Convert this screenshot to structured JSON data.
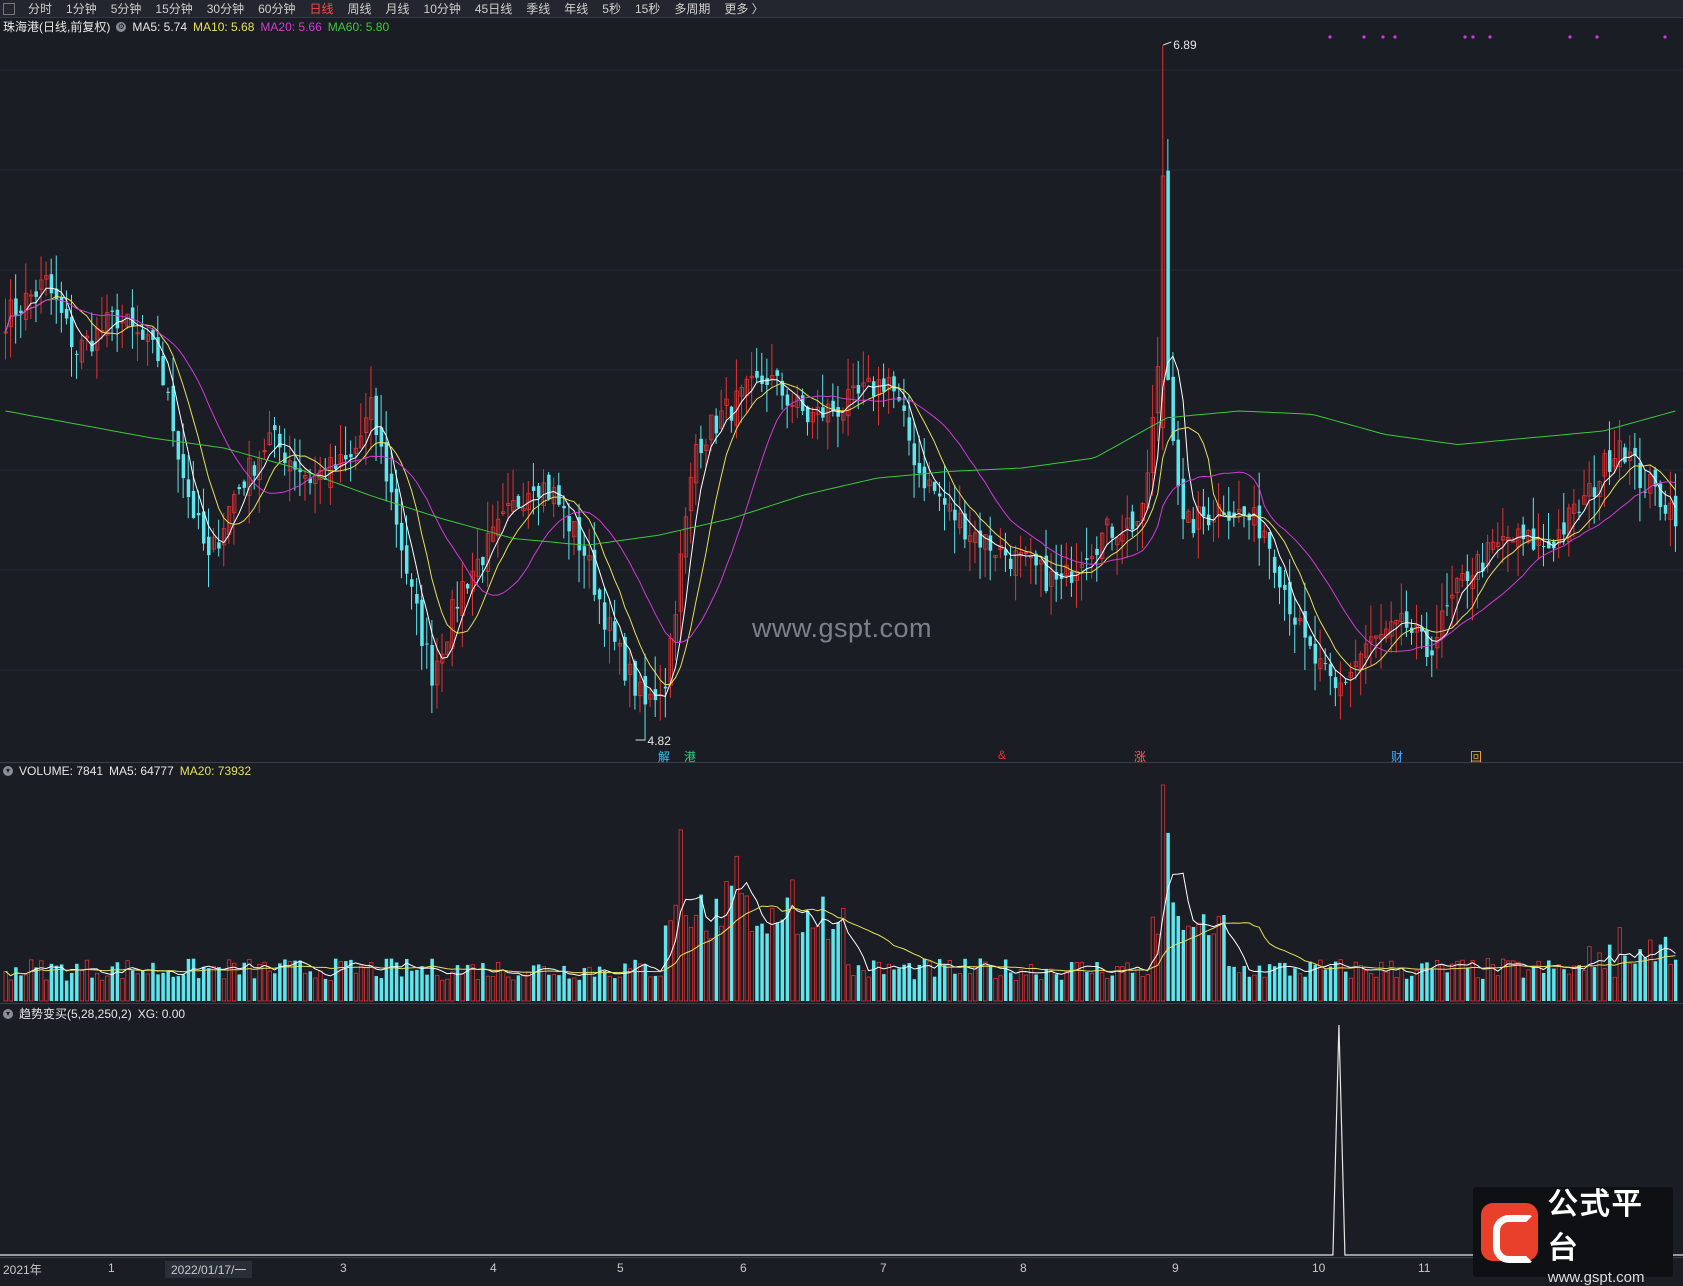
{
  "toolbar": {
    "periods": [
      "分时",
      "1分钟",
      "5分钟",
      "15分钟",
      "30分钟",
      "60分钟",
      "日线",
      "周线",
      "月线",
      "10分钟",
      "45日线",
      "季线",
      "年线",
      "5秒",
      "15秒",
      "多周期",
      "更多 〉"
    ],
    "active_index": 6
  },
  "price_legend": {
    "title": "珠海港(日线,前复权)",
    "ma5": "MA5: 5.74",
    "ma10": "MA10: 5.68",
    "ma20": "MA20: 5.66",
    "ma60": "MA60: 5.80"
  },
  "price_annotations": {
    "high": "6.89",
    "low": "4.82"
  },
  "events": [
    {
      "label": "解",
      "color": "#35c6e6"
    },
    {
      "label": "港",
      "color": "#34d27a"
    },
    {
      "label": "&",
      "color": "#e23333"
    },
    {
      "label": "涨",
      "color": "#ff5a5a"
    },
    {
      "label": "财",
      "color": "#4aa8ff"
    },
    {
      "label": "回",
      "color": "#f2a33a"
    }
  ],
  "volume_legend": {
    "title": "VOLUME: 7841",
    "ma5": "MA5: 64777",
    "ma20": "MA20: 73932"
  },
  "indicator_legend": {
    "title": "趋势变买(5,28,250,2)",
    "xg": "XG: 0.00"
  },
  "x_axis": [
    "2021年",
    "1",
    "2022/01/17/一",
    "3",
    "4",
    "5",
    "6",
    "7",
    "8",
    "9",
    "10",
    "11"
  ],
  "watermark": "www.gspt.com",
  "logo": {
    "name": "公式平台",
    "url": "www.gspt.com"
  },
  "colors": {
    "up": "#e23333",
    "down": "#5ee6ee",
    "ma5": "#ffffff",
    "ma10": "#e6e05a",
    "ma20": "#d23ad6",
    "ma60": "#3cc83c",
    "background": "#1b1d24"
  },
  "chart_data": {
    "type": "candlestick",
    "price_range": [
      4.82,
      6.89
    ],
    "ma60_closes": [
      5.8,
      5.76,
      5.72,
      5.69,
      5.63,
      5.55,
      5.48,
      5.42,
      5.4,
      5.43,
      5.48,
      5.55,
      5.6,
      5.62,
      5.63,
      5.66,
      5.78,
      5.8,
      5.79,
      5.73,
      5.7,
      5.72,
      5.74,
      5.8
    ],
    "volume_peaks": [
      212000,
      168000,
      165000
    ]
  }
}
